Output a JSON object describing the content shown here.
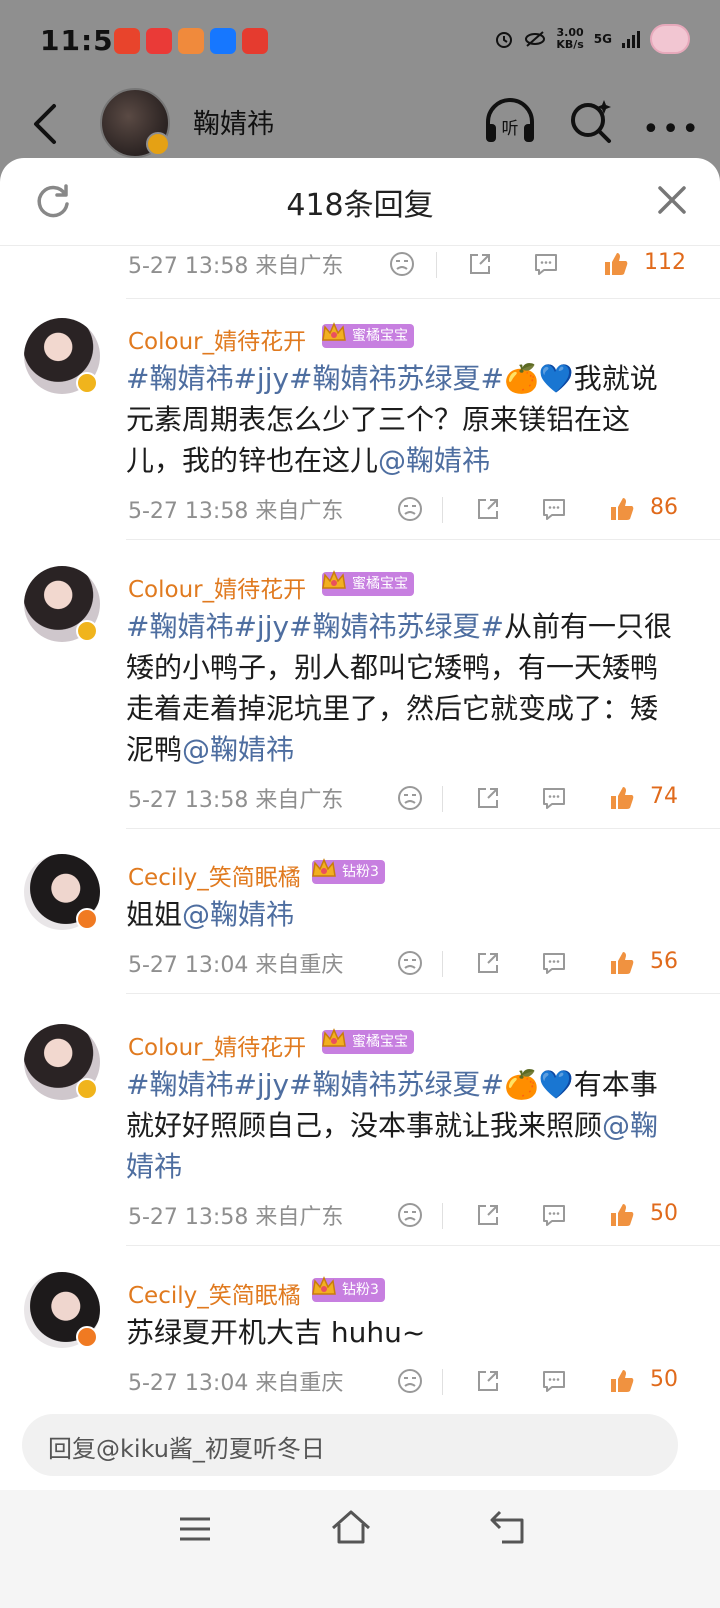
{
  "status_bar": {
    "time": "11:56",
    "speed_value": "3.00",
    "speed_unit": "KB/s",
    "network": "5G"
  },
  "header": {
    "profile_name": "鞠婧祎"
  },
  "sheet": {
    "title": "418条回复"
  },
  "top_meta": {
    "time_loc": "5-27 13:58  来自广东",
    "likes": "112"
  },
  "comments": [
    {
      "name": "Colour_婧待花开",
      "badge": "蜜橘宝宝",
      "segments": [
        {
          "t": "#鞠婧祎#jjy#鞠婧祎苏绿夏#",
          "c": "tag"
        },
        {
          "t": "🍊💙我就说元素周期表怎么少了三个？原来镁铝在这儿，我的锌也在这儿",
          "c": ""
        },
        {
          "t": "@鞠婧祎",
          "c": "mention"
        }
      ],
      "time_loc": "5-27 13:58  来自广东",
      "likes": "86"
    },
    {
      "name": "Colour_婧待花开",
      "badge": "蜜橘宝宝",
      "segments": [
        {
          "t": "#鞠婧祎#jjy#鞠婧祎苏绿夏#",
          "c": "tag"
        },
        {
          "t": "从前有一只很矮的小鸭子，别人都叫它矮鸭，有一天矮鸭走着走着掉泥坑里了，然后它就变成了：矮泥鸭",
          "c": ""
        },
        {
          "t": "@鞠婧祎",
          "c": "mention"
        }
      ],
      "time_loc": "5-27 13:58  来自广东",
      "likes": "74"
    },
    {
      "name": "Cecily_笑简眠橘",
      "badge": "钻粉3",
      "segments": [
        {
          "t": "姐姐",
          "c": ""
        },
        {
          "t": "@鞠婧祎",
          "c": "mention"
        }
      ],
      "time_loc": "5-27 13:04  来自重庆",
      "likes": "56"
    },
    {
      "name": "Colour_婧待花开",
      "badge": "蜜橘宝宝",
      "segments": [
        {
          "t": "#鞠婧祎#jjy#鞠婧祎苏绿夏#",
          "c": "tag"
        },
        {
          "t": "🍊💙有本事就好好照顾自己，没本事就让我来照顾",
          "c": ""
        },
        {
          "t": "@鞠婧祎",
          "c": "mention"
        }
      ],
      "time_loc": "5-27 13:58  来自广东",
      "likes": "50"
    },
    {
      "name": "Cecily_笑简眠橘",
      "badge": "钻粉3",
      "segments": [
        {
          "t": "苏绿夏开机大吉 huhu~",
          "c": ""
        }
      ],
      "time_loc": "5-27 13:04  来自重庆",
      "likes": "50"
    }
  ],
  "reply_input": {
    "placeholder": "回复@kiku酱_初夏听冬日"
  }
}
